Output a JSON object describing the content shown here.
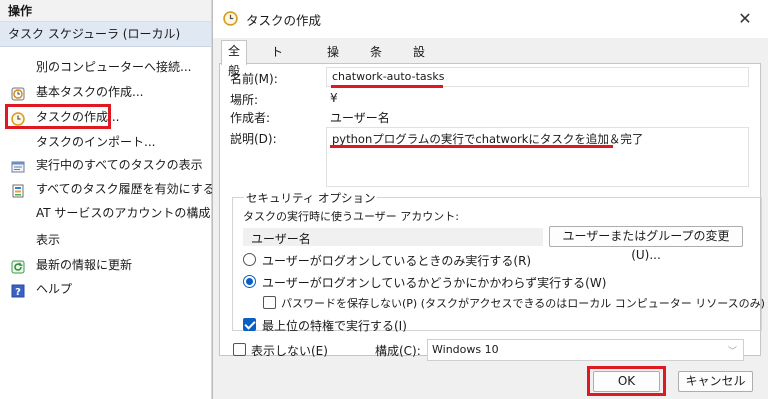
{
  "actions_pane": {
    "header": "操作",
    "section": "タスク スケジューラ (ローカル)",
    "items": [
      {
        "label": "別のコンピューターへ接続...",
        "icon": "none"
      },
      {
        "label": "基本タスクの作成...",
        "icon": "basic-task-icon"
      },
      {
        "label": "タスクの作成...",
        "icon": "clock-icon",
        "highlighted": true
      },
      {
        "label": "タスクのインポート...",
        "icon": "none"
      },
      {
        "label": "実行中のすべてのタスクの表示",
        "icon": "running-tasks-icon"
      },
      {
        "label": "すべてのタスク履歴を有効にする",
        "icon": "history-icon"
      },
      {
        "label": "AT サービスのアカウントの構成",
        "icon": "none"
      },
      {
        "label": "表示",
        "icon": "none"
      },
      {
        "label": "最新の情報に更新",
        "icon": "refresh-icon"
      },
      {
        "label": "ヘルプ",
        "icon": "help-icon"
      }
    ]
  },
  "dialog": {
    "title": "タスクの作成",
    "tabs": [
      "全般",
      "トリガー",
      "操作",
      "条件",
      "設定"
    ],
    "fields": {
      "name_label": "名前(M):",
      "name_value": "chatwork-auto-tasks",
      "location_label": "場所:",
      "location_value": "¥",
      "author_label": "作成者:",
      "author_value": "ユーザー名",
      "description_label": "説明(D):",
      "description_value": "pythonプログラムの実行でchatworkにタスクを追加＆完了"
    },
    "security": {
      "title": "セキュリティ オプション",
      "run_as_label": "タスクの実行時に使うユーザー アカウント:",
      "run_as_user": "ユーザー名",
      "change_user_button": "ユーザーまたはグループの変更(U)...",
      "radio_logged_on_only": "ユーザーがログオンしているときのみ実行する(R)",
      "radio_whether_logged_on": "ユーザーがログオンしているかどうかにかかわらず実行する(W)",
      "checkbox_no_password": "パスワードを保存しない(P) (タスクがアクセスできるのはローカル コンピューター リソースのみ)",
      "checkbox_highest_privileges": "最上位の特権で実行する(I)"
    },
    "hidden_label": "表示しない(E)",
    "configure_label": "構成(C):",
    "configure_value": "Windows 10",
    "ok_button": "OK",
    "cancel_button": "キャンセル"
  },
  "colors": {
    "highlight_red": "#e01823",
    "accent_blue": "#0a5fc2",
    "section_blue": "#dfe8f3"
  }
}
